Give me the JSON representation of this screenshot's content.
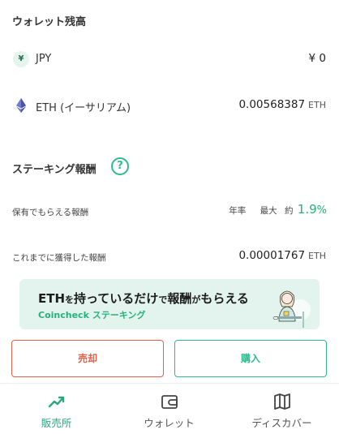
{
  "wallet": {
    "title": "ウォレット残高",
    "assets": [
      {
        "icon": "yen-icon",
        "icon_glyph": "¥",
        "name": "JPY",
        "value": "¥ 0",
        "unit": ""
      },
      {
        "icon": "ethereum-icon",
        "name": "ETH (イーサリアム)",
        "value": "0.00568387",
        "unit": "ETH"
      }
    ]
  },
  "staking": {
    "title": "ステーキング報酬",
    "help_glyph": "?",
    "reward_rate": {
      "label": "保有でもらえる報酬",
      "annual": "年率",
      "max": "最大",
      "approx": "約",
      "value": "1.9",
      "percent": "%"
    },
    "earned": {
      "label": "これまでに獲得した報酬",
      "value": "0.00001767",
      "unit": "ETH"
    }
  },
  "banner": {
    "line1_a": "ETH",
    "line1_b": "を",
    "line1_c": "持っているだけ",
    "line1_d": "で",
    "line1_e": "報酬",
    "line1_f": "が",
    "line1_g": "もらえる",
    "line2": "Coincheck ステーキング"
  },
  "actions": {
    "sell_label": "売却",
    "buy_label": "購入"
  },
  "tabs": [
    {
      "label": "販売所",
      "icon": "trend-up-icon",
      "active": true
    },
    {
      "label": "ウォレット",
      "icon": "wallet-icon",
      "active": false
    },
    {
      "label": "ディスカバー",
      "icon": "map-icon",
      "active": false
    }
  ],
  "colors": {
    "accent": "#2fbb8a",
    "sell": "#e2604a",
    "banner_bg": "#e3f4ef"
  }
}
